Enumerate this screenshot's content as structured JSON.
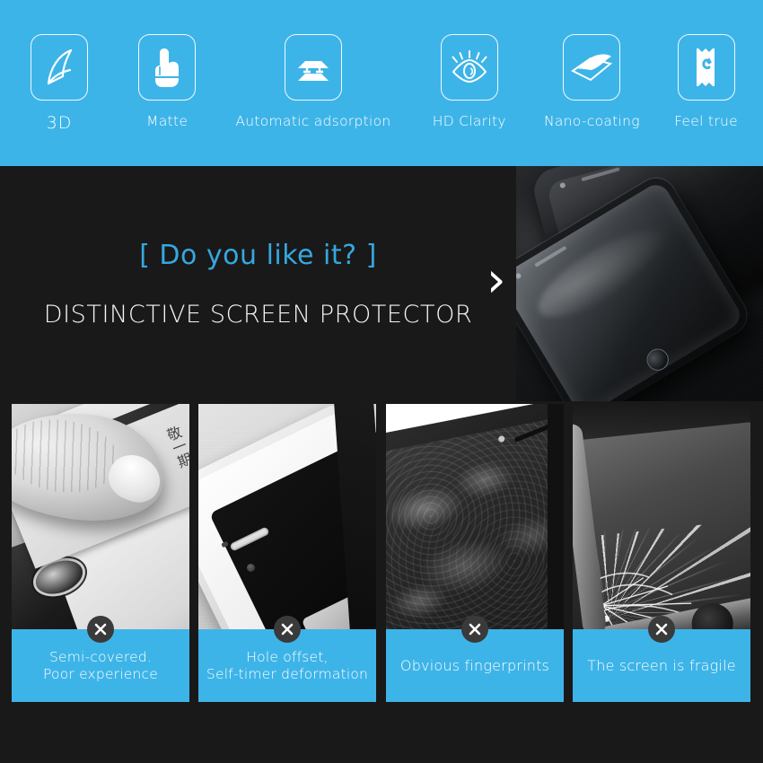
{
  "theme": {
    "accent_blue": "#3db4e8",
    "hero_accent_blue": "#35a8e0",
    "dark_bg": "#191919",
    "white": "#ffffff",
    "badge_gray": "#3a3a3a"
  },
  "feature_bar": {
    "features": [
      {
        "label": "3D",
        "icon": "curved-3d-sheet-icon"
      },
      {
        "label": "Matte",
        "icon": "pointing-hand-touch-icon"
      },
      {
        "label": "Automatic adsorption",
        "icon": "stacked-layers-adsorption-icon"
      },
      {
        "label": "HD Clarity",
        "icon": "eye-clarity-icon"
      },
      {
        "label": "Nano-coating",
        "icon": "peeling-film-layer-icon"
      },
      {
        "label": "Feel true",
        "icon": "ticket-swipe-arrow-icon"
      }
    ]
  },
  "hero": {
    "tagline": "[ Do you like it? ]",
    "headline": "DISTINCTIVE SCREEN PROTECTOR",
    "chevron": "›",
    "chevron_icon": "chevron-right-icon",
    "photo_alt": "two-black-phones-with-tempered-glass-on-dark-surface"
  },
  "panels": [
    {
      "caption": "Semi-covered.\nPoor experience",
      "badge": "x-mark-icon",
      "photo_alt": "finger-pressing-edge-of-partial-screen-protector"
    },
    {
      "caption": "Hole offset,\nSelf-timer deformation",
      "badge": "x-mark-icon",
      "photo_alt": "white-gold-phone-with-misaligned-protector-holes"
    },
    {
      "caption": "Obvious fingerprints",
      "badge": "x-mark-icon",
      "photo_alt": "dark-phone-screen-covered-in-greasy-fingerprints"
    },
    {
      "caption": "The screen is fragile",
      "badge": "x-mark-icon",
      "photo_alt": "phone-with-badly-shattered-cracked-screen"
    }
  ],
  "panel_1_photo_overlay_text": "敬一期"
}
